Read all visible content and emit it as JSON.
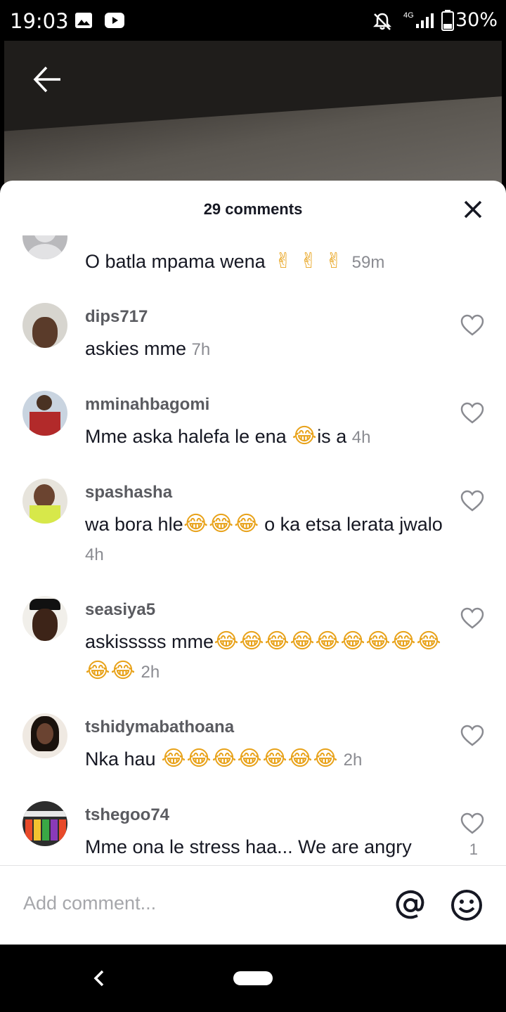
{
  "status_bar": {
    "time": "19:03",
    "network": "4G",
    "battery": "30%",
    "icons": [
      "gallery-icon",
      "youtube-icon",
      "notifications-off-icon",
      "signal-icon",
      "battery-icon"
    ]
  },
  "video": {
    "back_icon": "arrow-left-icon"
  },
  "sheet": {
    "title": "29 comments",
    "close_icon": "close-icon"
  },
  "comments": [
    {
      "username": "",
      "text": "O batla mpama wena",
      "emoji": [
        "✌",
        "✌",
        "✌"
      ],
      "time": "59m"
    },
    {
      "username": "dips717",
      "text": "askies mme",
      "emoji": [],
      "time": "7h"
    },
    {
      "username": "mminahbagomi",
      "text": "Mme aska halefa le ena",
      "emoji": [
        "😂"
      ],
      "text_after": "is a",
      "time": "4h"
    },
    {
      "username": "spashasha",
      "text": "wa bora hle",
      "emoji": [
        "😂",
        "😂",
        "😂"
      ],
      "text_after": " o ka etsa lerata jwalo",
      "time": "4h"
    },
    {
      "username": "seasiya5",
      "text": "askisssss mme",
      "emoji": [
        "😂",
        "😂",
        "😂",
        "😂",
        "😂",
        "😂",
        "😂",
        "😂",
        "😂",
        "😂",
        "😂"
      ],
      "time": "2h"
    },
    {
      "username": "tshidymabathoana",
      "text": "Nka hau ",
      "emoji": [
        "😂",
        "😂",
        "😂",
        "😂",
        "😂",
        "😂",
        "😂"
      ],
      "time": "2h"
    },
    {
      "username": "tshegoo74",
      "text": "Mme ona le stress haa... We are angry",
      "emoji": [],
      "time": "",
      "likes": "1"
    }
  ],
  "input": {
    "placeholder": "Add comment...",
    "mention_icon": "at-icon",
    "emoji_icon": "smiley-icon"
  },
  "nav_bar": {
    "icons": [
      "nav-back-icon",
      "nav-home-pill"
    ]
  }
}
